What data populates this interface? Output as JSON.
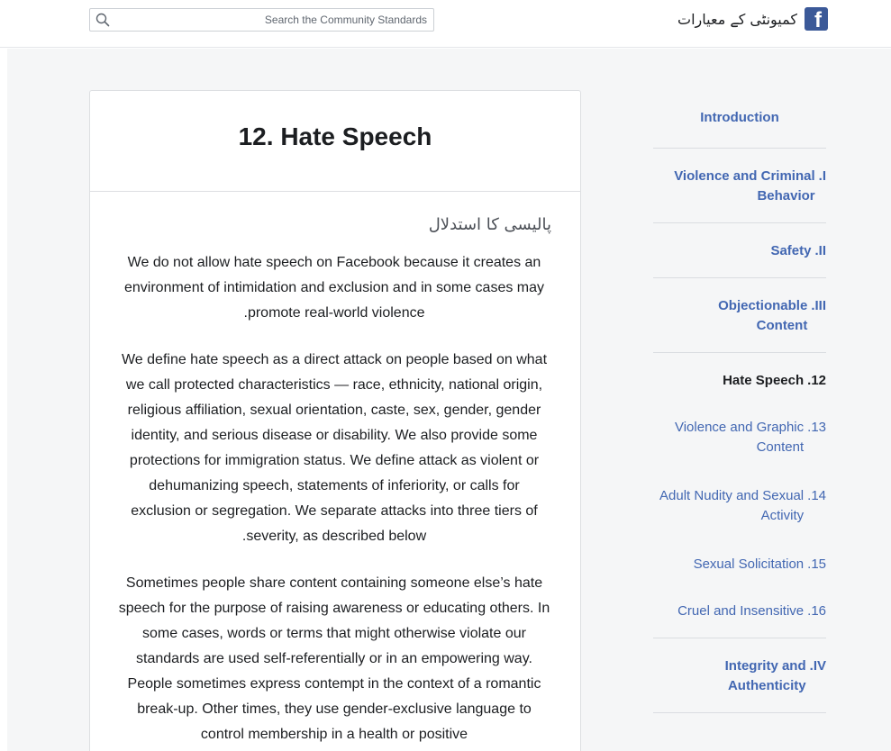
{
  "header": {
    "search_placeholder": "Search the Community Standards",
    "brand_name": "کمیونٹی کے معیارات",
    "logo_letter": "f"
  },
  "article": {
    "title": "12. Hate Speech",
    "section_heading": "پالیسی کا استدلال",
    "paragraphs": [
      "We do not allow hate speech on Facebook because it creates an environment of intimidation and exclusion and in some cases may promote real-world violence.",
      "We define hate speech as a direct attack on people based on what we call protected characteristics — race, ethnicity, national origin, religious affiliation, sexual orientation, caste, sex, gender, gender identity, and serious disease or disability. We also provide some protections for immigration status. We define attack as violent or dehumanizing speech, statements of inferiority, or calls for exclusion or segregation. We separate attacks into three tiers of severity, as described below.",
      "Sometimes people share content containing someone else’s hate speech for the purpose of raising awareness or educating others. In some cases, words or terms that might otherwise violate our standards are used self-referentially or in an empowering way. People sometimes express contempt in the context of a romantic break-up. Other times, they use gender-exclusive language to control membership in a health or positive"
    ]
  },
  "sidebar": {
    "items": [
      {
        "num": "",
        "label": "Introduction"
      },
      {
        "num": "I.",
        "label": "Violence and Criminal Behavior"
      },
      {
        "num": "II.",
        "label": "Safety"
      },
      {
        "num": "III.",
        "label": "Objectionable Content"
      },
      {
        "num": "12.",
        "label": "Hate Speech"
      },
      {
        "num": "13.",
        "label": "Violence and Graphic Content"
      },
      {
        "num": "14.",
        "label": "Adult Nudity and Sexual Activity"
      },
      {
        "num": "15.",
        "label": "Sexual Solicitation"
      },
      {
        "num": "16.",
        "label": "Cruel and Insensitive"
      },
      {
        "num": "IV.",
        "label": "Integrity and Authenticity"
      }
    ]
  },
  "colors": {
    "link_blue": "#4267b2",
    "facebook_blue": "#3b5998",
    "page_gray": "#f5f6f7",
    "text_dark": "#1c1e21"
  }
}
